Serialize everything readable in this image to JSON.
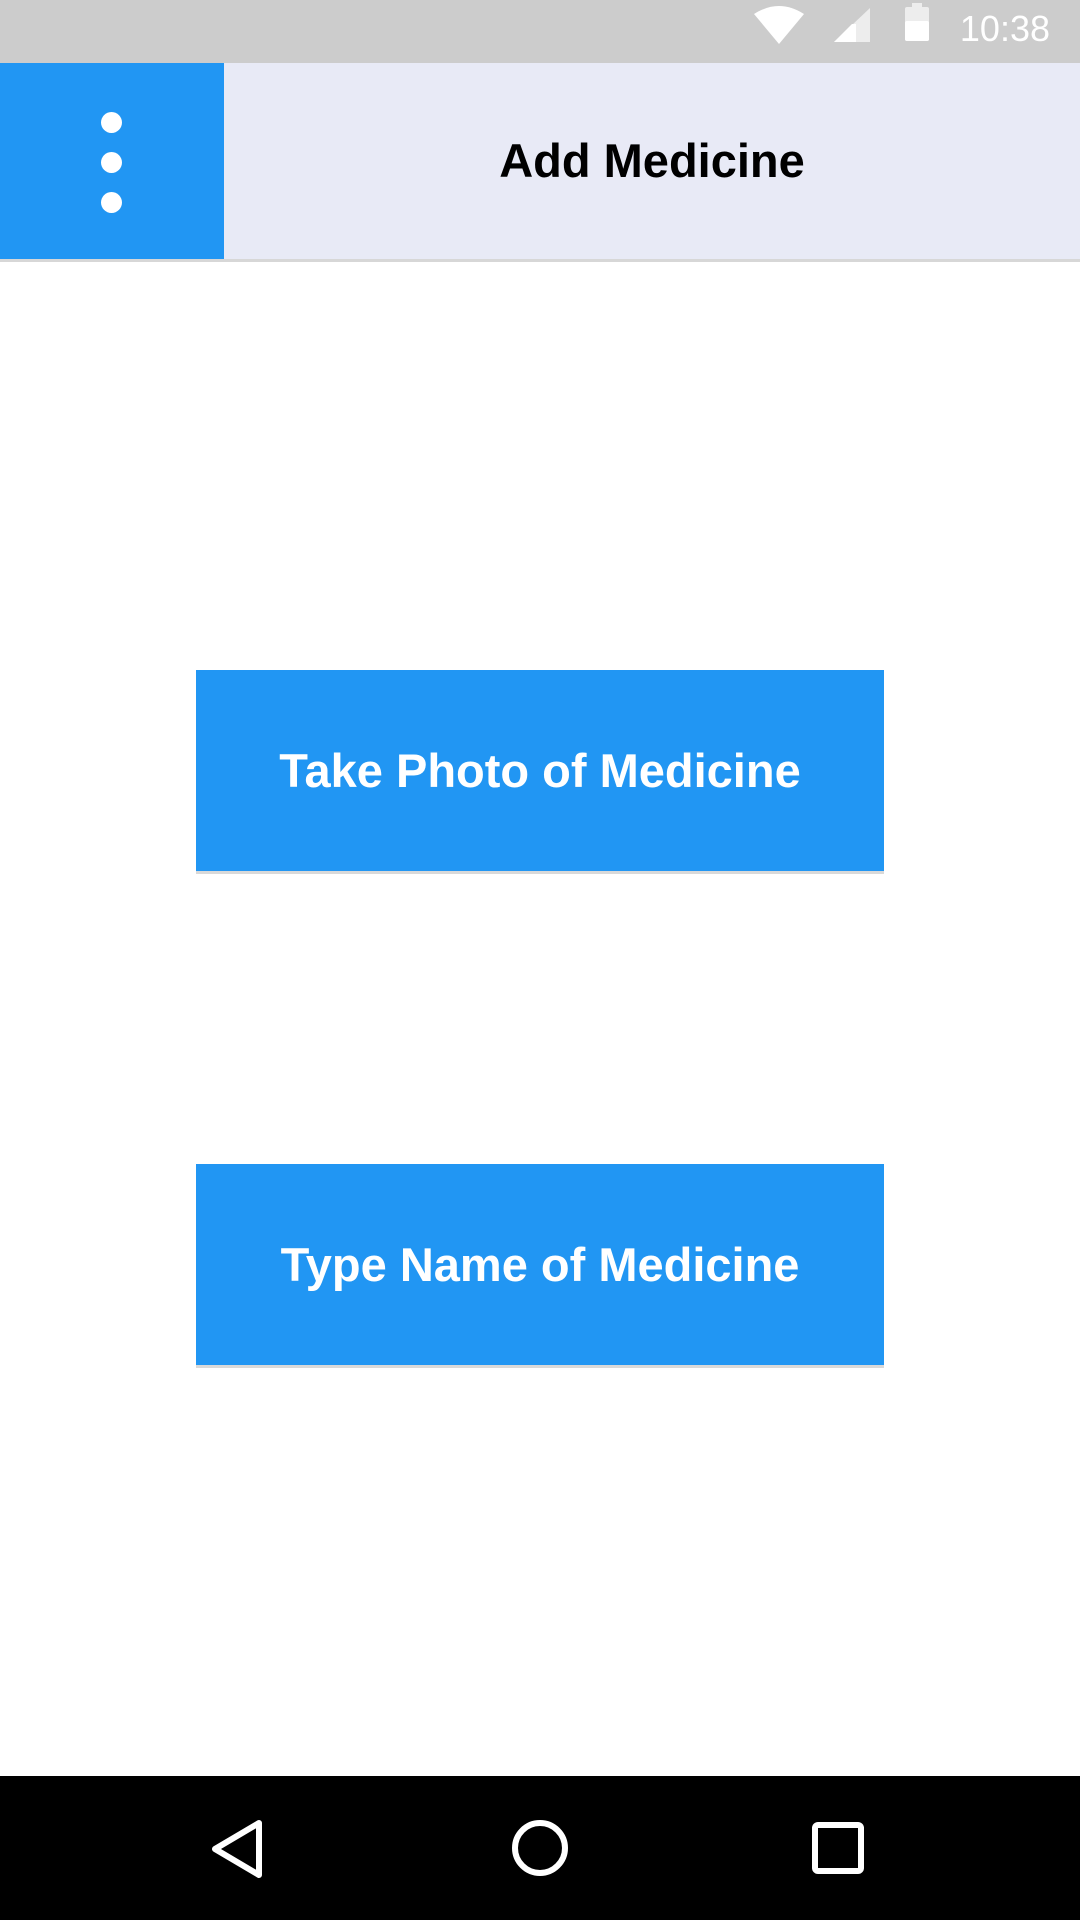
{
  "status_bar": {
    "time": "10:38",
    "icons": [
      "wifi-icon",
      "signal-icon",
      "battery-icon"
    ]
  },
  "app_bar": {
    "title": "Add Medicine",
    "menu_icon": "overflow-menu-icon"
  },
  "main": {
    "take_photo_label": "Take Photo of Medicine",
    "type_name_label": "Type Name of Medicine"
  },
  "nav_bar": {
    "icons": [
      "back-icon",
      "home-icon",
      "recents-icon"
    ]
  },
  "colors": {
    "accent": "#2196f3",
    "app_bar_bg": "#e8eaf6",
    "status_bar_bg": "#cccccc",
    "nav_bar_bg": "#000000"
  }
}
